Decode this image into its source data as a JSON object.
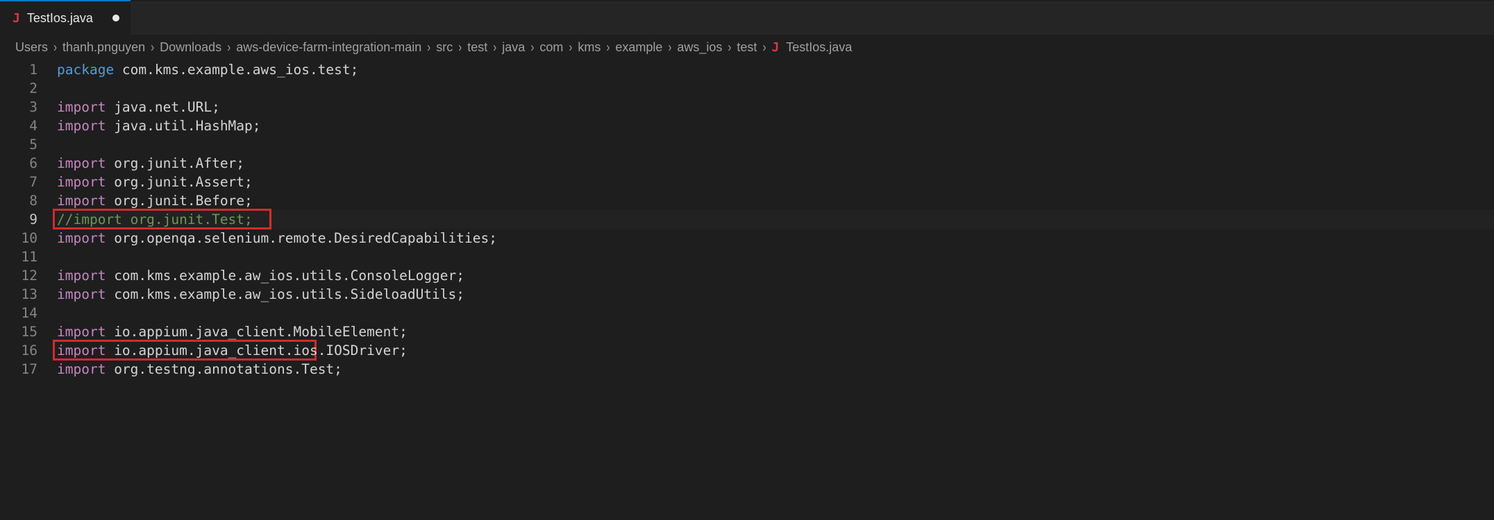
{
  "tab": {
    "label": "TestIos.java",
    "iconGlyph": "J",
    "dirty": true
  },
  "breadcrumbs": {
    "items": [
      "Users",
      "thanh.pnguyen",
      "Downloads",
      "aws-device-farm-integration-main",
      "src",
      "test",
      "java",
      "com",
      "kms",
      "example",
      "aws_ios",
      "test"
    ],
    "fileIconGlyph": "J",
    "file": "TestIos.java"
  },
  "code": {
    "lines": [
      {
        "n": 1,
        "type": "pkg",
        "kw": "package",
        "rest": " com.kms.example.aws_ios.test;"
      },
      {
        "n": 2,
        "type": "blank"
      },
      {
        "n": 3,
        "type": "import",
        "kw": "import",
        "rest": " java.net.URL;"
      },
      {
        "n": 4,
        "type": "import",
        "kw": "import",
        "rest": " java.util.HashMap;"
      },
      {
        "n": 5,
        "type": "blank"
      },
      {
        "n": 6,
        "type": "import",
        "kw": "import",
        "rest": " org.junit.After;"
      },
      {
        "n": 7,
        "type": "import",
        "kw": "import",
        "rest": " org.junit.Assert;"
      },
      {
        "n": 8,
        "type": "import",
        "kw": "import",
        "rest": " org.junit.Before;"
      },
      {
        "n": 9,
        "type": "comment",
        "text": "//import org.junit.Test;",
        "current": true
      },
      {
        "n": 10,
        "type": "import",
        "kw": "import",
        "rest": " org.openqa.selenium.remote.DesiredCapabilities;"
      },
      {
        "n": 11,
        "type": "blank"
      },
      {
        "n": 12,
        "type": "import",
        "kw": "import",
        "rest": " com.kms.example.aw_ios.utils.ConsoleLogger;"
      },
      {
        "n": 13,
        "type": "import",
        "kw": "import",
        "rest": " com.kms.example.aw_ios.utils.SideloadUtils;"
      },
      {
        "n": 14,
        "type": "blank"
      },
      {
        "n": 15,
        "type": "import",
        "kw": "import",
        "rest": " io.appium.java_client.MobileElement;"
      },
      {
        "n": 16,
        "type": "import",
        "kw": "import",
        "rest": " io.appium.java_client.ios.IOSDriver;"
      },
      {
        "n": 17,
        "type": "import",
        "kw": "import",
        "rest": " org.testng.annotations.Test;"
      }
    ],
    "currentLine": 9
  }
}
